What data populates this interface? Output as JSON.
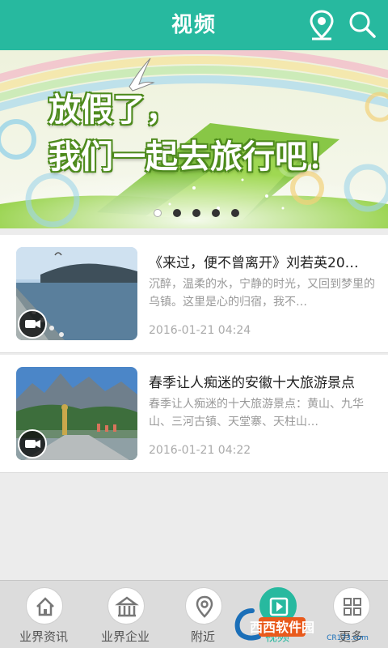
{
  "header": {
    "title": "视频"
  },
  "banner": {
    "line1": "放假了，",
    "line2": "我们一起去旅行吧！",
    "slide_count": 5,
    "active_index": 0
  },
  "articles": [
    {
      "title": "《来过，便不曾离开》刘若英20…",
      "summary": "沉醉，温柔的水，宁静的时光，又回到梦里的乌镇。这里是心的归宿，我不…",
      "date": "2016-01-21 04:24"
    },
    {
      "title": "春季让人痴迷的安徽十大旅游景点",
      "summary": "春季让人痴迷的十大旅游景点：黄山、九华山、三河古镇、天堂寨、天柱山…",
      "date": "2016-01-21 04:22"
    }
  ],
  "bottom_nav": {
    "items": [
      {
        "label": "业界资讯",
        "icon": "home-icon"
      },
      {
        "label": "业界企业",
        "icon": "building-icon"
      },
      {
        "label": "附近",
        "icon": "location-icon"
      },
      {
        "label": "视频",
        "icon": "play-icon",
        "active": true
      },
      {
        "label": "更多",
        "icon": "grid-icon"
      }
    ]
  },
  "watermark": {
    "text": "西西软件园",
    "sub": "CR173.com"
  },
  "colors": {
    "accent": "#27b99f",
    "background": "#ececec"
  }
}
